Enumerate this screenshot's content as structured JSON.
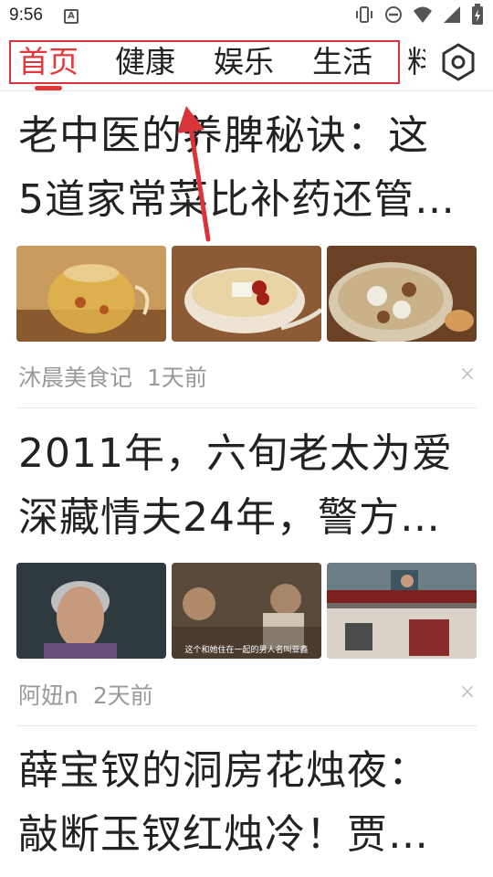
{
  "status_bar": {
    "time": "9:56",
    "app_icon": "A"
  },
  "tabs": [
    {
      "label": "首页",
      "active": true
    },
    {
      "label": "健康",
      "active": false
    },
    {
      "label": "娱乐",
      "active": false
    },
    {
      "label": "生活",
      "active": false
    }
  ],
  "tab_overflow_label": "料",
  "settings_icon": "hexagon-settings-icon",
  "colors": {
    "accent": "#e4393c",
    "annotation": "#d9343a",
    "meta_text": "#9a9a9a"
  },
  "articles": [
    {
      "title_line1": "老中医的养脾秘诀：这",
      "title_line2": "5道家常菜比补药还管…",
      "source": "沐晨美食记",
      "time": "1天前",
      "dismiss": "×"
    },
    {
      "title_line1": "2011年，六旬老太为爱",
      "title_line2": "深藏情夫24年，警方…",
      "source": "阿妞n",
      "time": "2天前",
      "dismiss": "×",
      "thumb_caption": "这个和她住在一起的男人名叫亚鑫"
    },
    {
      "title_line1": "薛宝钗的洞房花烛夜：",
      "title_line2": "敲断玉钗红烛冷！贾…"
    }
  ]
}
